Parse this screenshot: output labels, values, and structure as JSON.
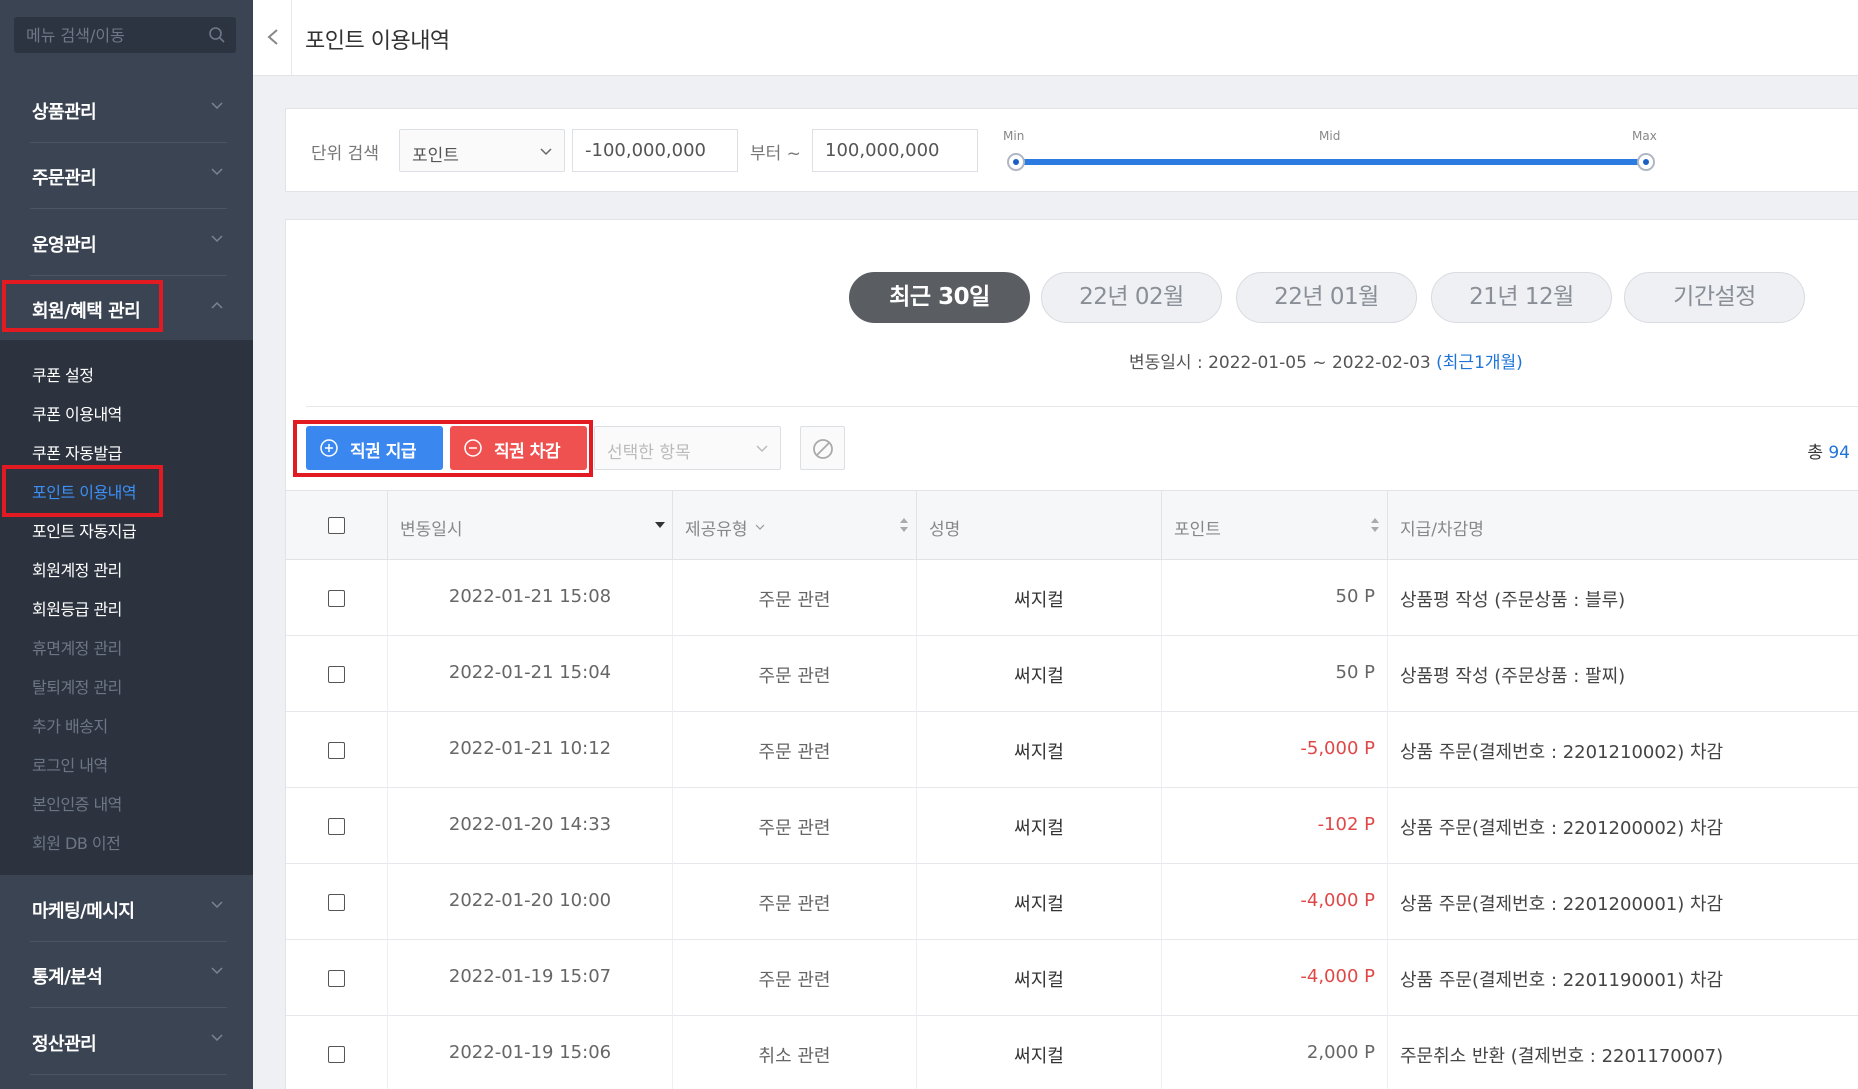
{
  "sidebar": {
    "search_placeholder": "메뉴 검색/이동",
    "groups_top": [
      {
        "label": "상품관리"
      },
      {
        "label": "주문관리"
      },
      {
        "label": "운영관리"
      },
      {
        "label": "회원/혜택 관리"
      }
    ],
    "sub_items": [
      {
        "label": "쿠폰 설정",
        "state": "normal"
      },
      {
        "label": "쿠폰 이용내역",
        "state": "normal"
      },
      {
        "label": "쿠폰 자동발급",
        "state": "normal"
      },
      {
        "label": "포인트 이용내역",
        "state": "active"
      },
      {
        "label": "포인트 자동지급",
        "state": "normal"
      },
      {
        "label": "회원계정 관리",
        "state": "normal"
      },
      {
        "label": "회원등급 관리",
        "state": "normal"
      },
      {
        "label": "휴면계정 관리",
        "state": "dim"
      },
      {
        "label": "탈퇴계정 관리",
        "state": "dim"
      },
      {
        "label": "추가 배송지",
        "state": "dim"
      },
      {
        "label": "로그인 내역",
        "state": "dim"
      },
      {
        "label": "본인인증 내역",
        "state": "dim"
      },
      {
        "label": "회원 DB 이전",
        "state": "dim"
      }
    ],
    "groups_bottom": [
      {
        "label": "마케팅/메시지"
      },
      {
        "label": "통계/분석"
      },
      {
        "label": "정산관리"
      }
    ]
  },
  "header": {
    "title": "포인트 이용내역"
  },
  "filter": {
    "label": "단위 검색",
    "unit_select": "포인트",
    "min_value": "-100,000,000",
    "range_text": "부터 ~",
    "max_value": "100,000,000",
    "slider_min": "Min",
    "slider_mid": "Mid",
    "slider_max": "Max",
    "slider_low_fraction": 0.0,
    "slider_high_fraction": 1.0
  },
  "periods": [
    {
      "label": "최근 30일",
      "active": true
    },
    {
      "label": "22년 02월",
      "active": false
    },
    {
      "label": "22년 01월",
      "active": false
    },
    {
      "label": "21년 12월",
      "active": false
    },
    {
      "label": "기간설정",
      "active": false
    }
  ],
  "period_text": {
    "prefix": "변동일시 : 2022-01-05 ~ 2022-02-03 ",
    "highlight": "(최근1개월)"
  },
  "actions": {
    "grant_label": "직권 지급",
    "deduct_label": "직권 차감",
    "selected_placeholder": "선택한 항목",
    "total_prefix": "총 ",
    "total_count": "94"
  },
  "table": {
    "headers": {
      "date": "변동일시",
      "type": "제공유형",
      "name": "성명",
      "point": "포인트",
      "desc": "지급/차감명"
    },
    "rows": [
      {
        "date": "2022-01-21 15:08",
        "type": "주문 관련",
        "name": "써지컬",
        "point": "50 P",
        "negative": false,
        "desc": "상품평 작성 (주문상품 : 블루)"
      },
      {
        "date": "2022-01-21 15:04",
        "type": "주문 관련",
        "name": "써지컬",
        "point": "50 P",
        "negative": false,
        "desc": "상품평 작성 (주문상품 : 팔찌)"
      },
      {
        "date": "2022-01-21 10:12",
        "type": "주문 관련",
        "name": "써지컬",
        "point": "-5,000 P",
        "negative": true,
        "desc": "상품 주문(결제번호 : 2201210002) 차감"
      },
      {
        "date": "2022-01-20 14:33",
        "type": "주문 관련",
        "name": "써지컬",
        "point": "-102 P",
        "negative": true,
        "desc": "상품 주문(결제번호 : 2201200002) 차감"
      },
      {
        "date": "2022-01-20 10:00",
        "type": "주문 관련",
        "name": "써지컬",
        "point": "-4,000 P",
        "negative": true,
        "desc": "상품 주문(결제번호 : 2201200001) 차감"
      },
      {
        "date": "2022-01-19 15:07",
        "type": "주문 관련",
        "name": "써지컬",
        "point": "-4,000 P",
        "negative": true,
        "desc": "상품 주문(결제번호 : 2201190001) 차감"
      },
      {
        "date": "2022-01-19 15:06",
        "type": "취소 관련",
        "name": "써지컬",
        "point": "2,000 P",
        "negative": false,
        "desc": "주문취소 반환 (결제번호 : 2201170007)"
      }
    ]
  },
  "colors": {
    "sidebar_bg": "#3b4453",
    "sidebar_sub_bg": "#2c333f",
    "active_link": "#3d8ff5",
    "grant_button": "#3a87f0",
    "deduct_button": "#ef5151",
    "negative_point": "#e04848",
    "highlight_box": "#e21b23"
  }
}
